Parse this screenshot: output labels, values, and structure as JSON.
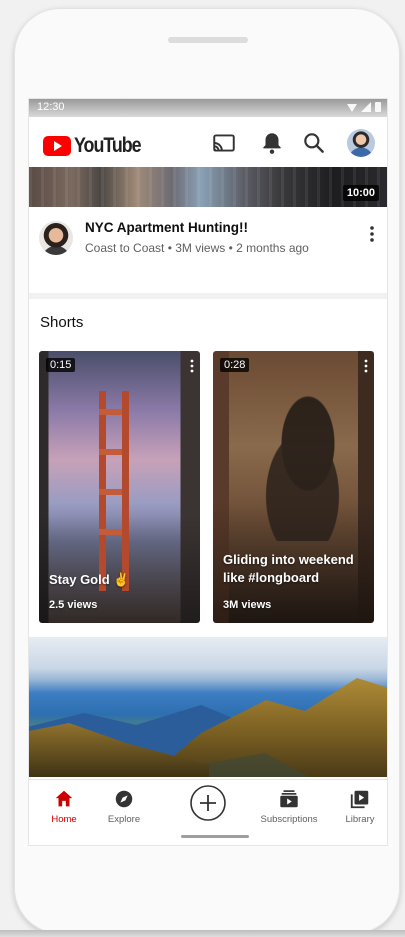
{
  "status_bar": {
    "time": "12:30"
  },
  "app_bar": {
    "logo_text": "YouTube"
  },
  "top_video": {
    "duration": "10:00",
    "title": "NYC Apartment Hunting!!",
    "meta": "Coast to Coast • 3M views • 2 months ago"
  },
  "shorts": {
    "section_title": "Shorts",
    "items": [
      {
        "duration": "0:15",
        "title": "Stay Gold ✌",
        "views": "2.5 views"
      },
      {
        "duration": "0:28",
        "title": "Gliding into weekend like #longboard",
        "views": "3M views"
      }
    ]
  },
  "bottom_nav": {
    "items": [
      {
        "label": "Home",
        "icon": "home-icon"
      },
      {
        "label": "Explore",
        "icon": "compass-icon"
      },
      {
        "label": "",
        "icon": "create-icon"
      },
      {
        "label": "Subscriptions",
        "icon": "subscriptions-icon"
      },
      {
        "label": "Library",
        "icon": "library-icon"
      }
    ]
  },
  "colors": {
    "brand_red": "#ff0000",
    "active_nav": "#cc0000",
    "text_primary": "#0f0f0f",
    "text_secondary": "#606060"
  }
}
